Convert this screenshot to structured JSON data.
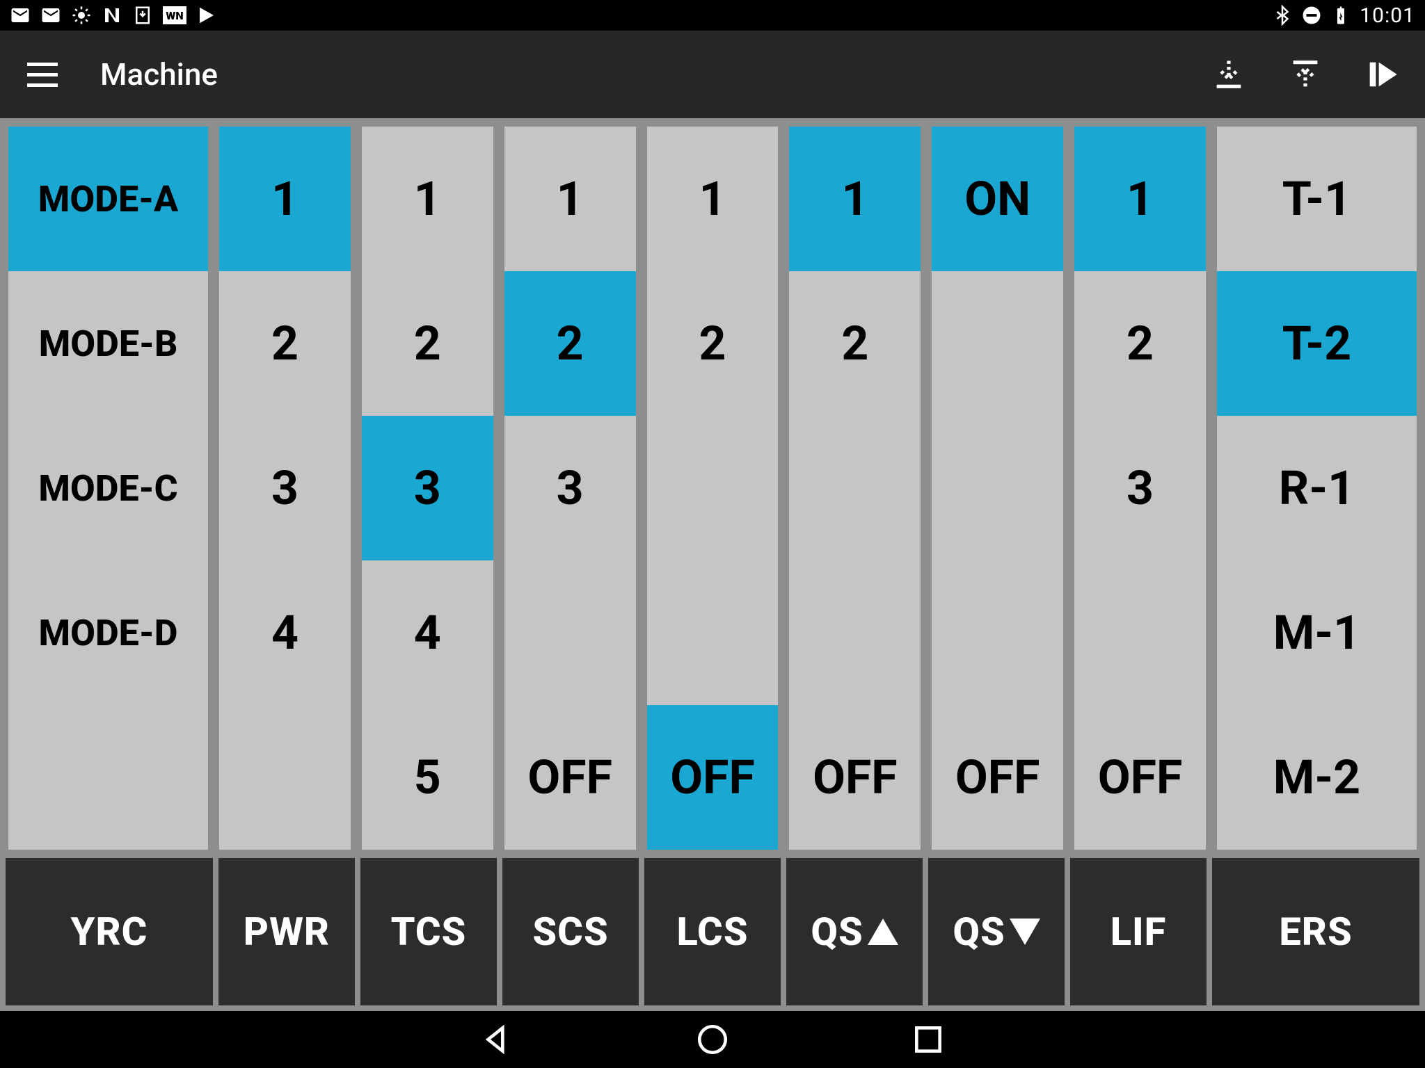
{
  "status": {
    "time": "10:01"
  },
  "appbar": {
    "title": "Machine"
  },
  "columns": [
    {
      "id": "yrc",
      "wide": true,
      "header": "YRC",
      "options": [
        "MODE-A",
        "MODE-B",
        "MODE-C",
        "MODE-D",
        "",
        ""
      ],
      "selected": 0,
      "modeLabels": true
    },
    {
      "id": "pwr",
      "wide": false,
      "header": "PWR",
      "options": [
        "1",
        "2",
        "3",
        "4",
        "",
        ""
      ],
      "selected": 0
    },
    {
      "id": "tcs",
      "wide": false,
      "header": "TCS",
      "options": [
        "1",
        "2",
        "3",
        "4",
        "5",
        ""
      ],
      "selected": 2
    },
    {
      "id": "scs",
      "wide": false,
      "header": "SCS",
      "options": [
        "1",
        "2",
        "3",
        "",
        "OFF",
        ""
      ],
      "selected": 1
    },
    {
      "id": "lcs",
      "wide": false,
      "header": "LCS",
      "options": [
        "1",
        "2",
        "",
        "",
        "OFF",
        ""
      ],
      "selected": 4
    },
    {
      "id": "qsu",
      "wide": false,
      "header": "QS",
      "headerSuffix": "up",
      "options": [
        "1",
        "2",
        "",
        "",
        "OFF",
        ""
      ],
      "selected": 0
    },
    {
      "id": "qsd",
      "wide": false,
      "header": "QS",
      "headerSuffix": "down",
      "options": [
        "ON",
        "",
        "",
        "",
        "OFF",
        ""
      ],
      "selected": 0
    },
    {
      "id": "lif",
      "wide": false,
      "header": "LIF",
      "options": [
        "1",
        "2",
        "3",
        "",
        "OFF",
        ""
      ],
      "selected": 0
    },
    {
      "id": "ers",
      "wide": true,
      "header": "ERS",
      "options": [
        "T-1",
        "T-2",
        "R-1",
        "M-1",
        "M-2",
        ""
      ],
      "selected": 1
    }
  ]
}
